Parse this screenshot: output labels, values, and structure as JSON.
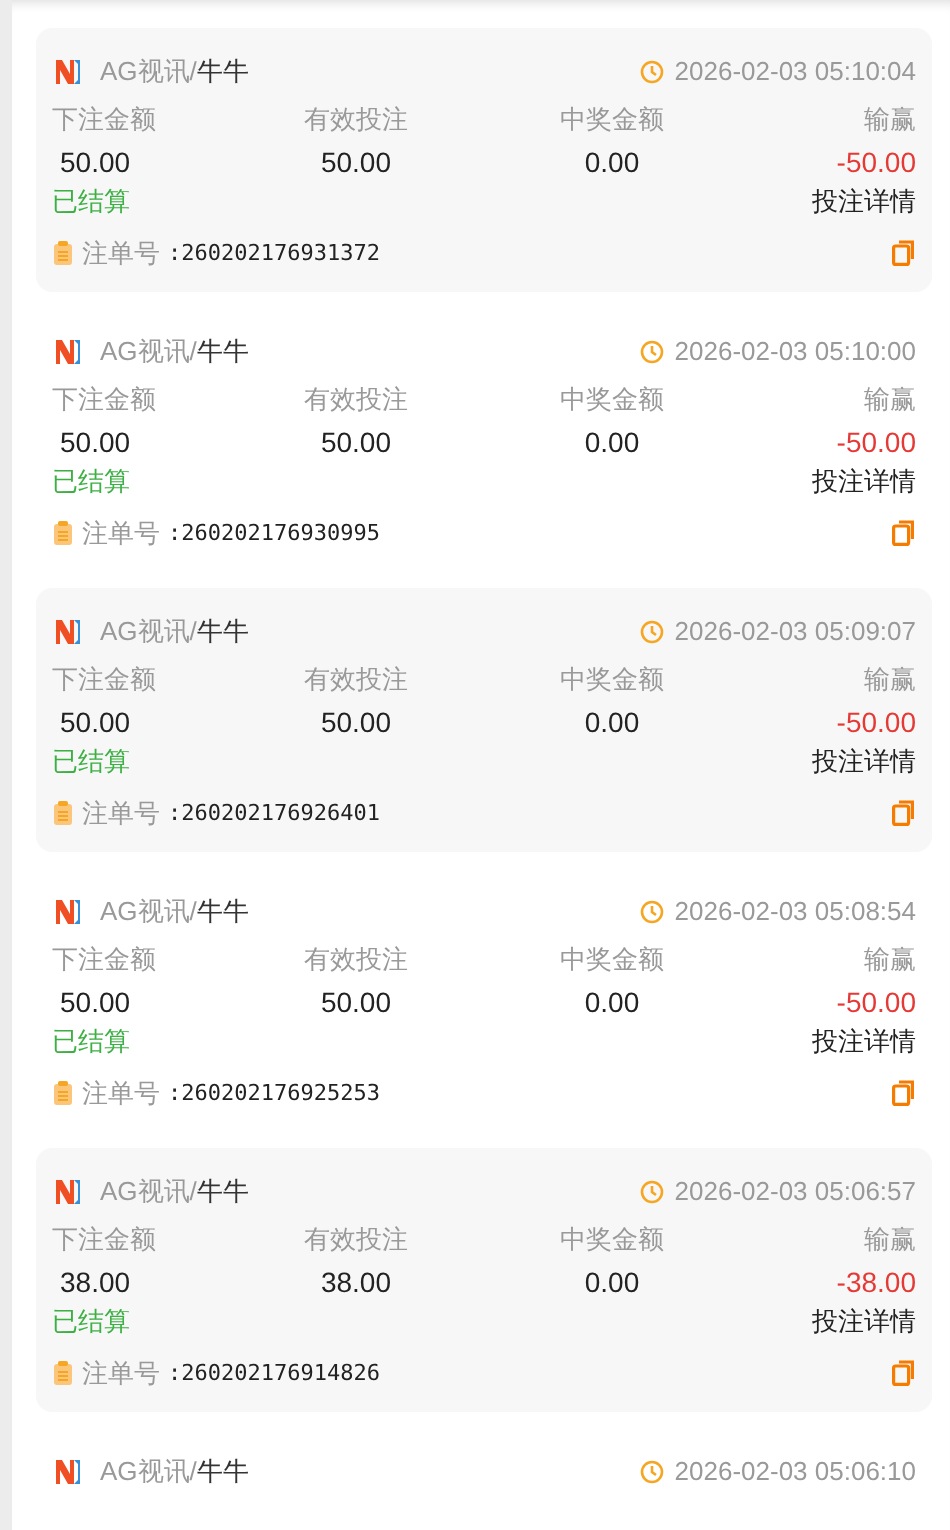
{
  "records": [
    {
      "platform": "AG视讯",
      "separator": "/",
      "game": "牛牛",
      "time": "2026-02-03 05:10:04",
      "labels": [
        "下注金额",
        "有效投注",
        "中奖金额",
        "输赢"
      ],
      "bet": "50.00",
      "valid": "50.00",
      "payout": "0.00",
      "result": "-50.00",
      "status": "已结算",
      "detail_link": "投注详情",
      "order_label": "注单号",
      "order_no": ":260202176931372"
    },
    {
      "platform": "AG视讯",
      "separator": "/",
      "game": "牛牛",
      "time": "2026-02-03 05:10:00",
      "labels": [
        "下注金额",
        "有效投注",
        "中奖金额",
        "输赢"
      ],
      "bet": "50.00",
      "valid": "50.00",
      "payout": "0.00",
      "result": "-50.00",
      "status": "已结算",
      "detail_link": "投注详情",
      "order_label": "注单号",
      "order_no": ":260202176930995"
    },
    {
      "platform": "AG视讯",
      "separator": "/",
      "game": "牛牛",
      "time": "2026-02-03 05:09:07",
      "labels": [
        "下注金额",
        "有效投注",
        "中奖金额",
        "输赢"
      ],
      "bet": "50.00",
      "valid": "50.00",
      "payout": "0.00",
      "result": "-50.00",
      "status": "已结算",
      "detail_link": "投注详情",
      "order_label": "注单号",
      "order_no": ":260202176926401"
    },
    {
      "platform": "AG视讯",
      "separator": "/",
      "game": "牛牛",
      "time": "2026-02-03 05:08:54",
      "labels": [
        "下注金额",
        "有效投注",
        "中奖金额",
        "输赢"
      ],
      "bet": "50.00",
      "valid": "50.00",
      "payout": "0.00",
      "result": "-50.00",
      "status": "已结算",
      "detail_link": "投注详情",
      "order_label": "注单号",
      "order_no": ":260202176925253"
    },
    {
      "platform": "AG视讯",
      "separator": "/",
      "game": "牛牛",
      "time": "2026-02-03 05:06:57",
      "labels": [
        "下注金额",
        "有效投注",
        "中奖金额",
        "输赢"
      ],
      "bet": "38.00",
      "valid": "38.00",
      "payout": "0.00",
      "result": "-38.00",
      "status": "已结算",
      "detail_link": "投注详情",
      "order_label": "注单号",
      "order_no": ":260202176914826"
    },
    {
      "platform": "AG视讯",
      "separator": "/",
      "game": "牛牛",
      "time": "2026-02-03 05:06:10"
    }
  ]
}
